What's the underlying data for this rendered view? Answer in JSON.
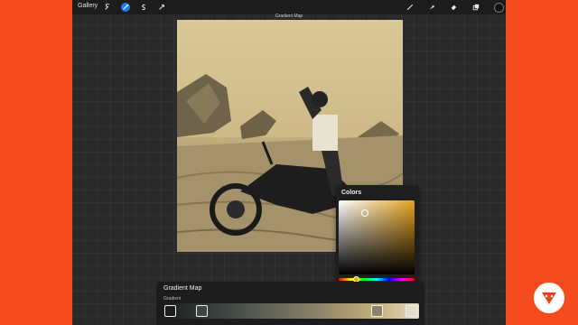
{
  "app": {
    "gallery_label": "Gallery",
    "document_title": "Gradient Map"
  },
  "toolbar": {
    "left_tools": [
      {
        "name": "actions",
        "icon": "wrench-icon"
      },
      {
        "name": "adjustments",
        "icon": "magic-wand-icon",
        "active": true
      },
      {
        "name": "selection",
        "icon": "selection-s-icon"
      },
      {
        "name": "transform",
        "icon": "arrow-cursor-icon"
      }
    ],
    "right_tools": [
      {
        "name": "brush",
        "icon": "brush-icon"
      },
      {
        "name": "smudge",
        "icon": "smudge-icon"
      },
      {
        "name": "eraser",
        "icon": "eraser-icon"
      },
      {
        "name": "layers",
        "icon": "layers-icon"
      }
    ],
    "current_color": "#111111",
    "accent_color": "#1e7cf2"
  },
  "colors_panel": {
    "title": "Colors",
    "selected_hue": "#e6a21c",
    "tabs": [
      {
        "name": "disc",
        "icon": "disc-icon"
      },
      {
        "name": "classic",
        "icon": "classic-square-icon",
        "active": true
      },
      {
        "name": "harmony",
        "icon": "harmony-icon"
      },
      {
        "name": "value",
        "icon": "sliders-icon"
      },
      {
        "name": "palettes",
        "icon": "grid-icon"
      }
    ]
  },
  "gradient_map": {
    "title": "Gradient Map",
    "subtitle": "Gradient",
    "stops": [
      "#1b1b1b",
      "#3b4744",
      "#8c8266",
      "#e2dccb"
    ]
  },
  "brand": {
    "logo_icon": "domestika-logo-icon",
    "logo_color": "#e8401c"
  }
}
